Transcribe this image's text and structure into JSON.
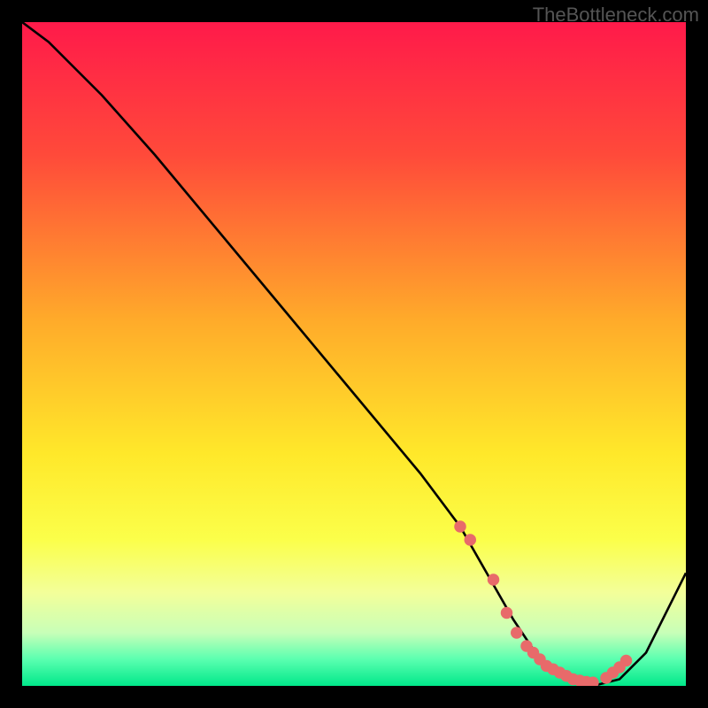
{
  "watermark": "TheBottleneck.com",
  "chart_data": {
    "type": "line",
    "title": "",
    "xlabel": "",
    "ylabel": "",
    "xlim": [
      0,
      100
    ],
    "ylim": [
      0,
      100
    ],
    "gradient_stops": [
      {
        "pos": 0,
        "color": "#ff1a4a"
      },
      {
        "pos": 20,
        "color": "#ff4a3a"
      },
      {
        "pos": 45,
        "color": "#ffab2a"
      },
      {
        "pos": 65,
        "color": "#ffe82a"
      },
      {
        "pos": 78,
        "color": "#fbff4a"
      },
      {
        "pos": 86,
        "color": "#f3ff9a"
      },
      {
        "pos": 92,
        "color": "#c8ffb8"
      },
      {
        "pos": 96,
        "color": "#5affb0"
      },
      {
        "pos": 100,
        "color": "#00e88a"
      }
    ],
    "series": [
      {
        "name": "bottleneck-curve",
        "x": [
          0,
          4,
          8,
          12,
          20,
          30,
          40,
          50,
          60,
          66,
          70,
          74,
          78,
          82,
          86,
          90,
          94,
          100
        ],
        "y": [
          100,
          97,
          93,
          89,
          80,
          68,
          56,
          44,
          32,
          24,
          17,
          10,
          4,
          1,
          0,
          1,
          5,
          17
        ]
      }
    ],
    "markers": {
      "name": "highlight-points",
      "color": "#e86a6a",
      "x": [
        66,
        67.5,
        71,
        73,
        74.5,
        76,
        77,
        78,
        79,
        80,
        81,
        82,
        83,
        84,
        85,
        86,
        88,
        89,
        90,
        91
      ],
      "y": [
        24,
        22,
        16,
        11,
        8,
        6,
        5,
        4,
        3,
        2.5,
        2,
        1.5,
        1,
        0.8,
        0.6,
        0.5,
        1.2,
        2,
        2.8,
        3.8
      ]
    }
  }
}
